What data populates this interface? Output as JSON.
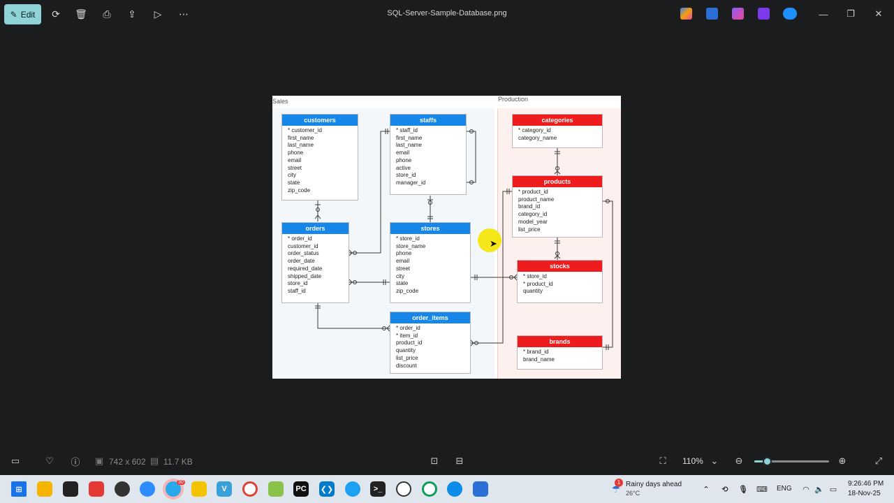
{
  "toolbar": {
    "edit_label": "Edit",
    "title": "SQL-Server-Sample-Database.png"
  },
  "diagram": {
    "sales_label": "Sales",
    "production_label": "Production",
    "entities": {
      "customers": {
        "name": "customers",
        "fields": [
          "* customer_id",
          "first_name",
          "last_name",
          "phone",
          "email",
          "street",
          "city",
          "state",
          "zip_code"
        ]
      },
      "staffs": {
        "name": "staffs",
        "fields": [
          "* staff_id",
          "first_name",
          "last_name",
          "email",
          "phone",
          "active",
          "store_id",
          "manager_id"
        ]
      },
      "orders": {
        "name": "orders",
        "fields": [
          "* order_id",
          "customer_id",
          "order_status",
          "order_date",
          "required_date",
          "shipped_date",
          "store_id",
          "staff_id"
        ]
      },
      "stores": {
        "name": "stores",
        "fields": [
          "* store_id",
          "store_name",
          "phone",
          "email",
          "street",
          "city",
          "state",
          "zip_code"
        ]
      },
      "order_items": {
        "name": "order_items",
        "fields": [
          "* order_id",
          "* item_id",
          "product_id",
          "quantity",
          "list_price",
          "discount"
        ]
      },
      "categories": {
        "name": "categories",
        "fields": [
          "* category_id",
          "category_name"
        ]
      },
      "products": {
        "name": "products",
        "fields": [
          "* product_id",
          "product_name",
          "brand_id",
          "category_id",
          "model_year",
          "list_price"
        ]
      },
      "stocks": {
        "name": "stocks",
        "fields": [
          "* store_id",
          "* product_id",
          "quantity"
        ]
      },
      "brands": {
        "name": "brands",
        "fields": [
          "* brand_id",
          "brand_name"
        ]
      }
    }
  },
  "statusbar": {
    "dimensions": "742 x 602",
    "file_size": "11.7 KB",
    "zoom": "110%",
    "zoom_level": 0.12
  },
  "taskbar": {
    "weather_title": "Rainy days ahead",
    "weather_temp": "26°C",
    "weather_badge": "1",
    "language": "ENG",
    "time": "9:26:46 PM",
    "date": "18-Nov-25",
    "telegram_badge": "30"
  },
  "colors": {
    "accent": "#8fd3d7",
    "sales_header": "#1687e8",
    "production_header": "#ee1c1c"
  }
}
